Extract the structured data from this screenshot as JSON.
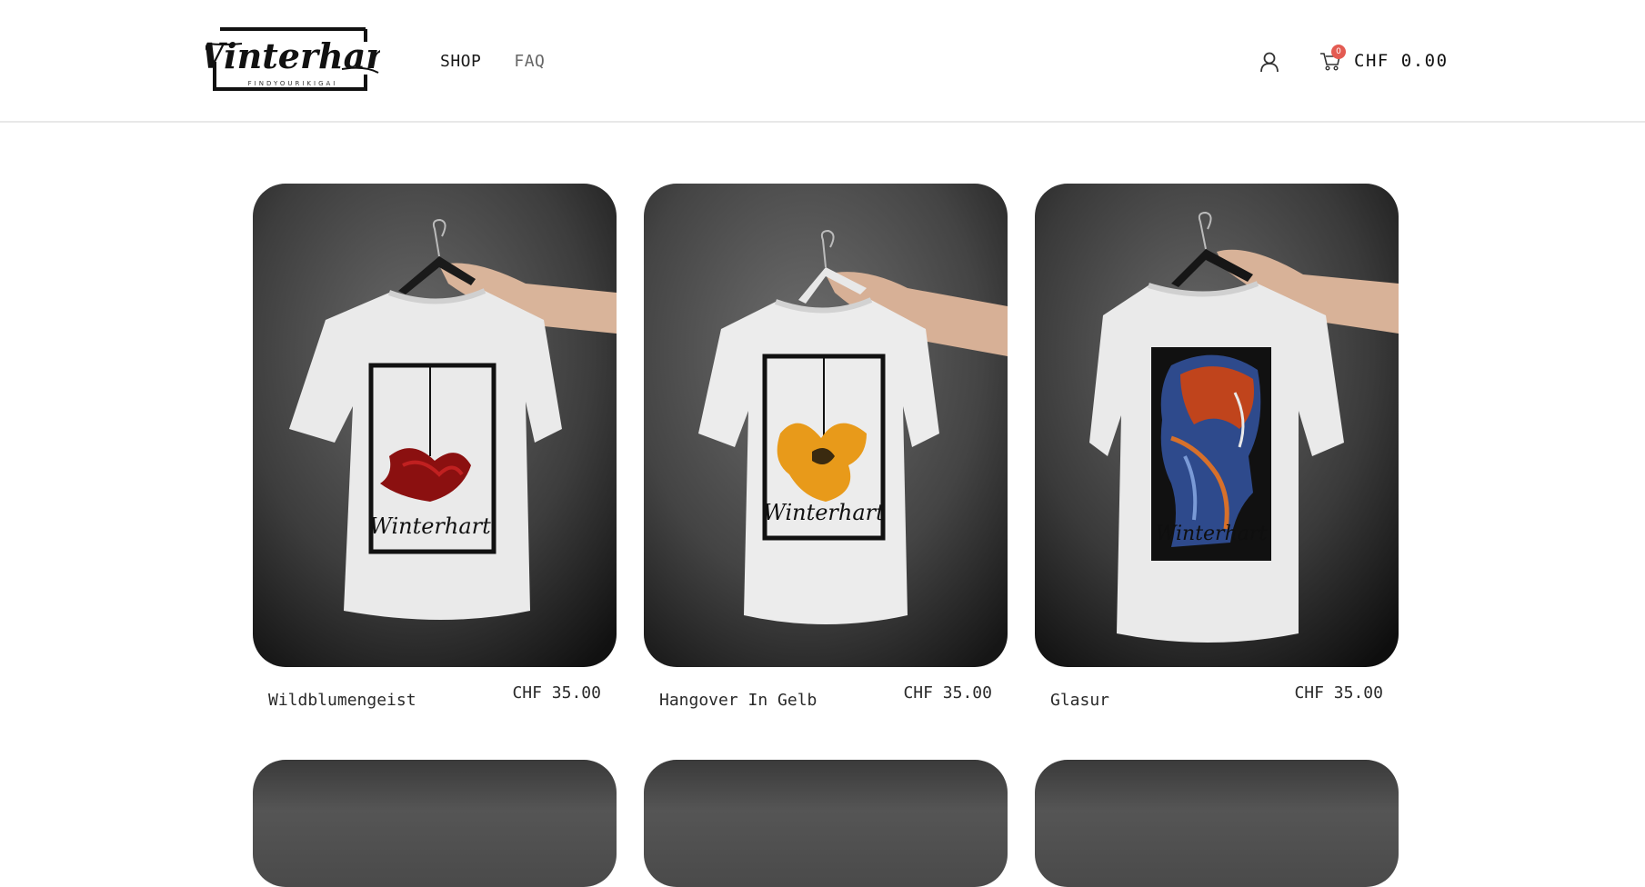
{
  "header": {
    "logo_text": "Winterhart",
    "logo_tagline": "FINDYOURIKIGAI",
    "nav": [
      {
        "label": "SHOP"
      },
      {
        "label": "FAQ"
      }
    ],
    "cart": {
      "count": "0",
      "total": "CHF 0.00"
    }
  },
  "products": [
    {
      "name": "Wildblumengeist",
      "price": "CHF 35.00",
      "print": "red-flower"
    },
    {
      "name": "Hangover In Gelb",
      "price": "CHF 35.00",
      "print": "yellow-flower"
    },
    {
      "name": "Glasur",
      "price": "CHF 35.00",
      "print": "glass-portrait"
    }
  ],
  "colors": {
    "cart_badge": "#e35b52",
    "background_grey": "#4a4a4a"
  }
}
